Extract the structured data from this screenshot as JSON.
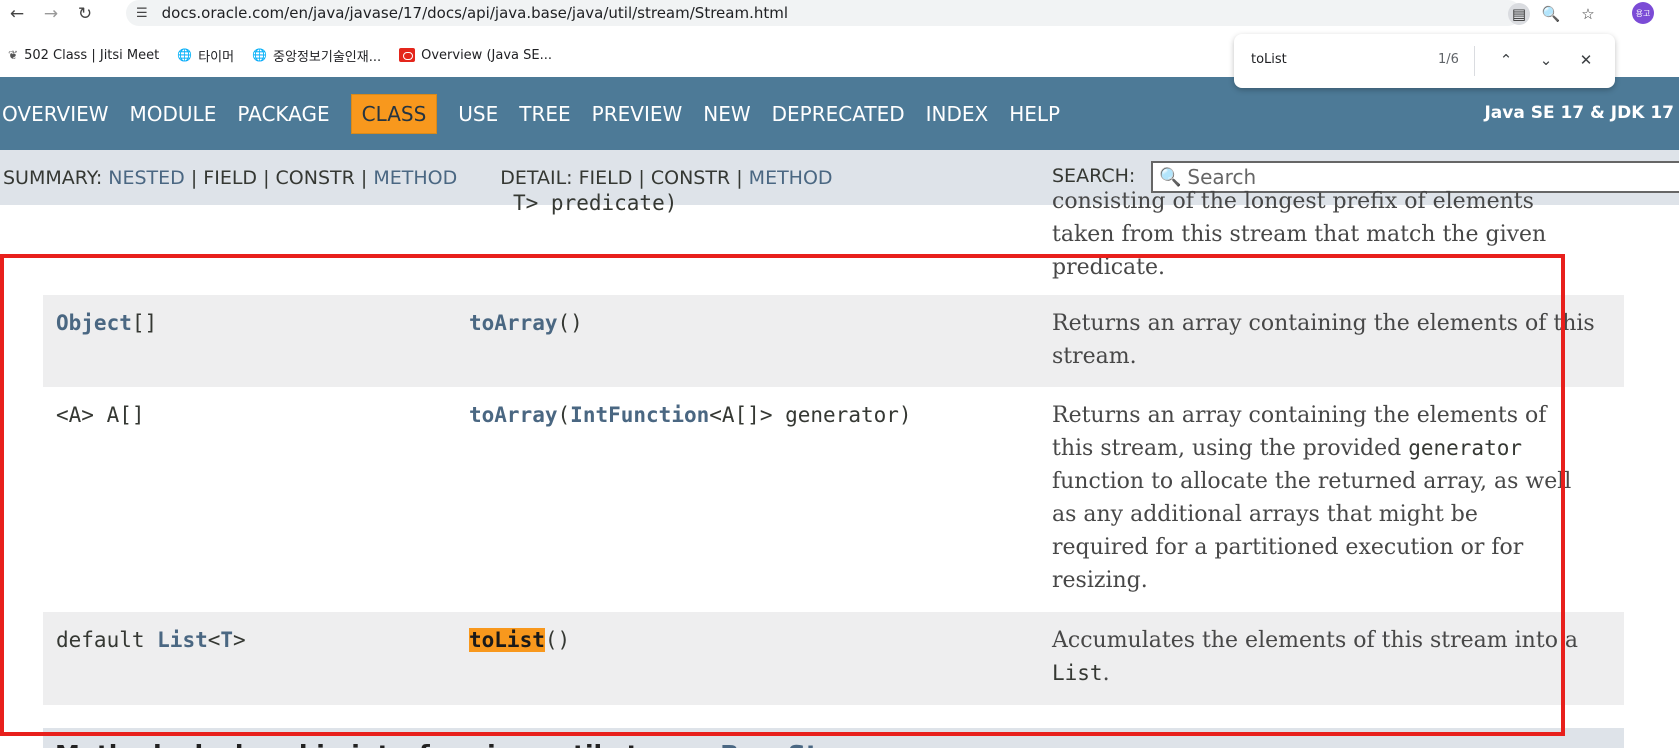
{
  "browser": {
    "url": "docs.oracle.com/en/java/javase/17/docs/api/java.base/java/util/stream/Stream.html",
    "avatar_label": "용고",
    "bookmarks": [
      {
        "label": "502 Class | Jitsi Meet",
        "icon": "leaf-icon"
      },
      {
        "label": "타이머",
        "icon": "globe-icon"
      },
      {
        "label": "중앙정보기술인재...",
        "icon": "globe-icon"
      },
      {
        "label": "Overview (Java SE...",
        "icon": "oracle-icon"
      }
    ]
  },
  "findbar": {
    "query": "toList",
    "count": "1/6"
  },
  "javadoc": {
    "nav": [
      "OVERVIEW",
      "MODULE",
      "PACKAGE",
      "CLASS",
      "USE",
      "TREE",
      "PREVIEW",
      "NEW",
      "DEPRECATED",
      "INDEX",
      "HELP"
    ],
    "active_nav": "CLASS",
    "brand": "Java SE 17 & JDK 17",
    "subnav": {
      "summary_label": "SUMMARY: ",
      "nested": "NESTED",
      "sep": " | ",
      "field": "FIELD",
      "constr": "CONSTR",
      "method": "METHOD",
      "detail_label": "DETAIL: ",
      "search_label": "SEARCH:",
      "search_placeholder": "Search"
    }
  },
  "table": {
    "partial": {
      "code": "T> predicate)",
      "desc_lines": [
        "consisting of the longest prefix of elements",
        "taken from this stream that match the given",
        "predicate."
      ]
    },
    "rows": [
      {
        "modifier_link": "Object",
        "modifier_suffix": "[]",
        "method_link": "toArray",
        "method_args": "()",
        "desc": "Returns an array containing the elements of this stream."
      },
      {
        "modifier_text": "<A> A[]",
        "method_link": "toArray",
        "method_args_open": "(",
        "method_args_link": "IntFunction",
        "method_args_rest": "<A[]> generator)",
        "desc_pre": "Returns an array containing the elements of this stream, using the provided ",
        "desc_code": "generator",
        "desc_post": " function to allocate the returned array, as well as any additional arrays that might be required for a partitioned execution or for resizing."
      },
      {
        "modifier_pre": "default ",
        "modifier_link": "List",
        "modifier_lt": "<",
        "modifier_type": "T",
        "modifier_gt": ">",
        "method_link": "toList",
        "method_args": "()",
        "desc_pre": "Accumulates the elements of this stream into a ",
        "desc_code": "List",
        "desc_post": "."
      }
    ]
  },
  "section": {
    "title_pre": "Methods declared in interface java.util.stream.",
    "title_link": "BaseStream"
  }
}
